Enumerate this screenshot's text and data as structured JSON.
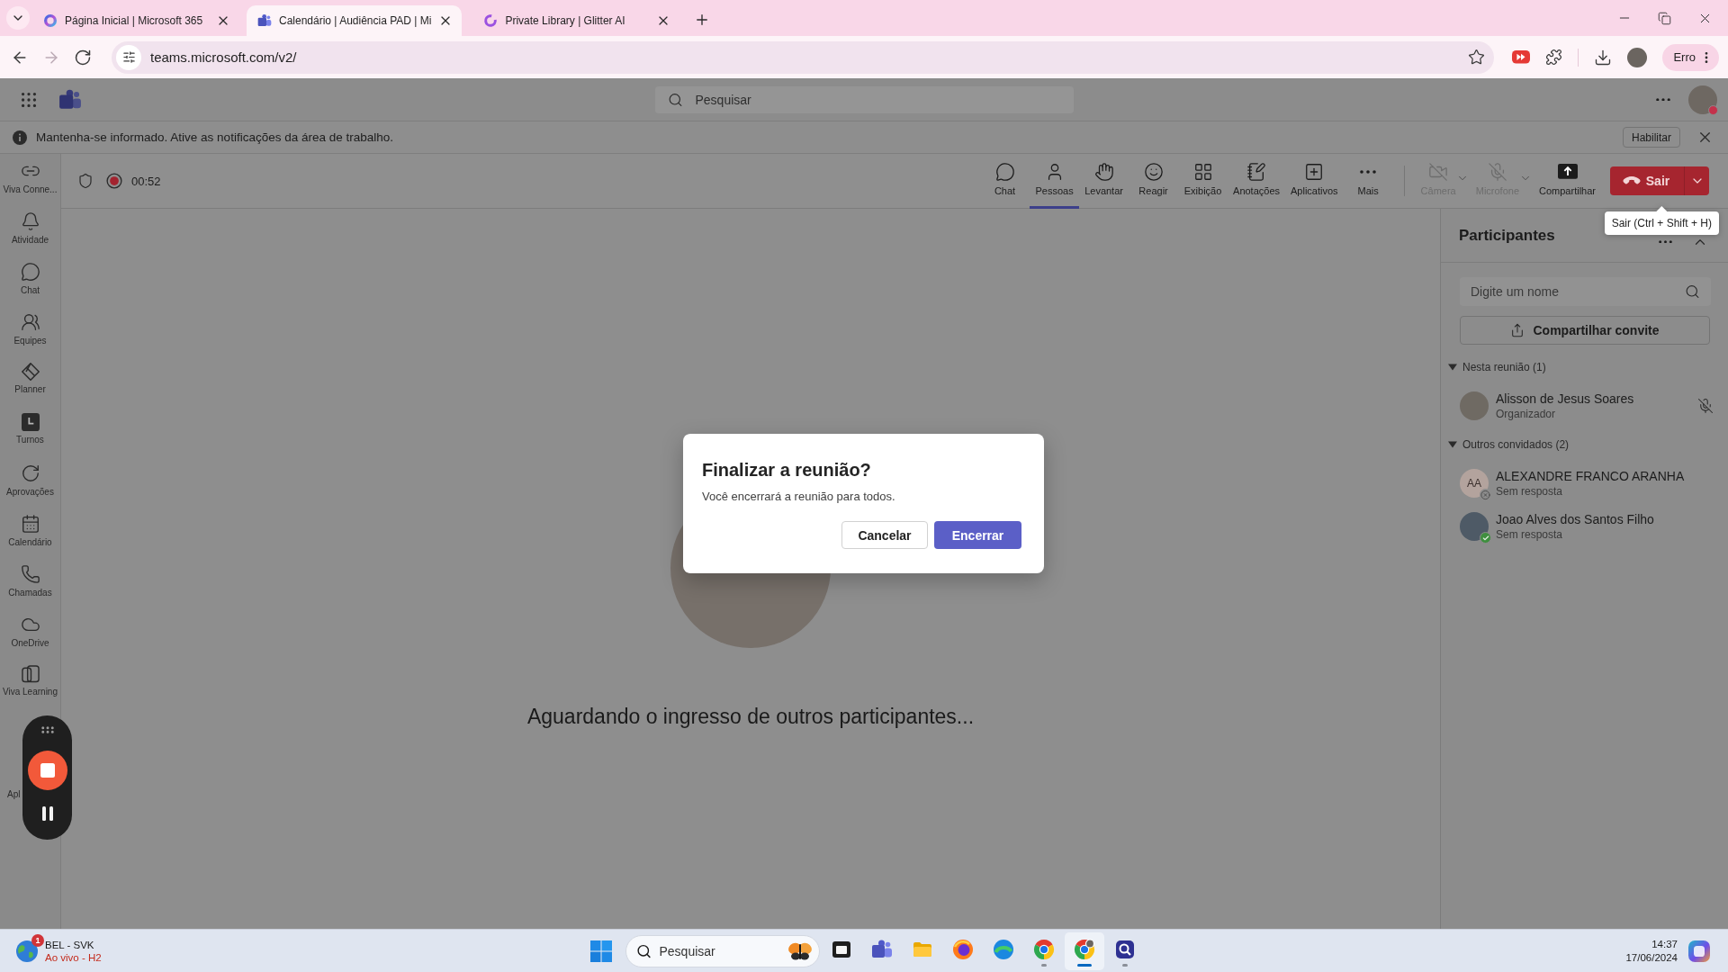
{
  "browser": {
    "tabs": [
      {
        "title": "Página Inicial | Microsoft 365",
        "selected": false
      },
      {
        "title": "Calendário | Audiência PAD | Mi",
        "selected": true
      },
      {
        "title": "Private Library | Glitter AI",
        "selected": false
      }
    ],
    "nav_buttons": [
      {
        "disabled": false
      },
      {
        "disabled": true
      },
      {
        "disabled": false
      }
    ],
    "url": "teams.microsoft.com/v2/",
    "profile_chip": "Erro"
  },
  "teams_header": {
    "search": {
      "placeholder": "Pesquisar"
    },
    "user_busy": true
  },
  "notice": {
    "text": "Mantenha-se informado. Ative as notificações da área de trabalho.",
    "button": "Habilitar"
  },
  "rail": {
    "items": [
      {
        "label": "Viva Conne..."
      },
      {
        "label": "Atividade"
      },
      {
        "label": "Chat"
      },
      {
        "label": "Equipes"
      },
      {
        "label": "Planner"
      },
      {
        "label": "Turnos"
      },
      {
        "label": "Aprovações"
      },
      {
        "label": "Calendário"
      },
      {
        "label": "Chamadas"
      },
      {
        "label": "OneDrive"
      },
      {
        "label": "Viva Learning"
      }
    ],
    "partial_label": "Apl"
  },
  "meeting": {
    "recording": true,
    "timer": "00:52",
    "actions": [
      {
        "label": "Chat",
        "selected": false,
        "disabled": false,
        "dropdown": false
      },
      {
        "label": "Pessoas",
        "selected": true,
        "disabled": false,
        "dropdown": false
      },
      {
        "label": "Levantar",
        "selected": false,
        "disabled": false,
        "dropdown": false
      },
      {
        "label": "Reagir",
        "selected": false,
        "disabled": false,
        "dropdown": false
      },
      {
        "label": "Exibição",
        "selected": false,
        "disabled": false,
        "dropdown": false
      },
      {
        "label": "Anotações",
        "selected": false,
        "disabled": false,
        "dropdown": false
      },
      {
        "label": "Aplicativos",
        "selected": false,
        "disabled": false,
        "dropdown": false
      },
      {
        "label": "Mais",
        "selected": false,
        "disabled": false,
        "dropdown": false
      }
    ],
    "devices": [
      {
        "label": "Câmera",
        "selected": false,
        "disabled": true,
        "dropdown": true
      },
      {
        "label": "Microfone",
        "selected": false,
        "disabled": true,
        "dropdown": true
      },
      {
        "label": "Compartilhar",
        "selected": false,
        "disabled": false,
        "dropdown": false
      }
    ],
    "leave": {
      "label": "Sair",
      "tooltip": "Sair (Ctrl + Shift + H)"
    }
  },
  "stage": {
    "status": "Aguardando o ingresso de outros participantes..."
  },
  "dialog": {
    "title": "Finalizar a reunião?",
    "message": "Você encerrará a reunião para todos.",
    "buttons": [
      {
        "label": "Cancelar",
        "kind": "secondary"
      },
      {
        "label": "Encerrar",
        "kind": "primary"
      }
    ]
  },
  "participants": {
    "title": "Participantes",
    "search": {
      "placeholder": "Digite um nome"
    },
    "invite": "Compartilhar convite",
    "groups": [
      {
        "label": "Nesta reunião (1)",
        "expanded": true,
        "people": [
          {
            "name": "Alisson de Jesus Soares",
            "role": "Organizador",
            "kind": "photo",
            "muted": true
          }
        ]
      },
      {
        "label": "Outros convidados (2)",
        "expanded": true,
        "people": [
          {
            "name": "ALEXANDRE FRANCO ARANHA",
            "role": "Sem resposta",
            "kind": "initials",
            "initials": "AA",
            "online": false,
            "muted": false
          },
          {
            "name": "Joao Alves dos Santos Filho",
            "role": "Sem resposta",
            "kind": "photo",
            "online": true,
            "muted": false
          }
        ]
      }
    ]
  },
  "taskbar": {
    "news": {
      "badge": "1",
      "title": "BEL - SVK",
      "subtitle": "Ao vivo - H2"
    },
    "search": {
      "placeholder": "Pesquisar"
    },
    "apps": [
      {
        "running": false,
        "selected": false
      },
      {
        "running": false,
        "selected": false
      },
      {
        "running": false,
        "selected": false
      },
      {
        "running": false,
        "selected": false
      },
      {
        "running": false,
        "selected": false
      },
      {
        "running": true,
        "selected": false
      },
      {
        "running": true,
        "selected": true
      },
      {
        "running": true,
        "selected": false
      }
    ],
    "time": "14:37",
    "date": "17/06/2024"
  }
}
